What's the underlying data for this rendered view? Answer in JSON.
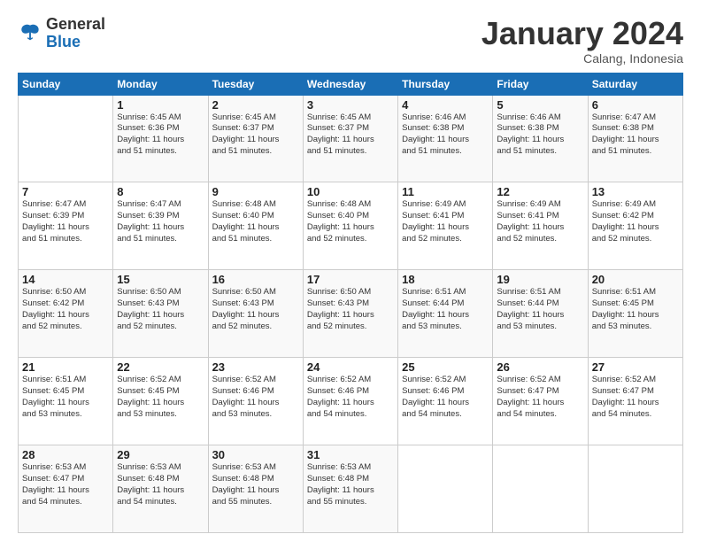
{
  "header": {
    "logo_general": "General",
    "logo_blue": "Blue",
    "month_title": "January 2024",
    "location": "Calang, Indonesia"
  },
  "days_of_week": [
    "Sunday",
    "Monday",
    "Tuesday",
    "Wednesday",
    "Thursday",
    "Friday",
    "Saturday"
  ],
  "weeks": [
    [
      {
        "day": "",
        "info": ""
      },
      {
        "day": "1",
        "info": "Sunrise: 6:45 AM\nSunset: 6:36 PM\nDaylight: 11 hours\nand 51 minutes."
      },
      {
        "day": "2",
        "info": "Sunrise: 6:45 AM\nSunset: 6:37 PM\nDaylight: 11 hours\nand 51 minutes."
      },
      {
        "day": "3",
        "info": "Sunrise: 6:45 AM\nSunset: 6:37 PM\nDaylight: 11 hours\nand 51 minutes."
      },
      {
        "day": "4",
        "info": "Sunrise: 6:46 AM\nSunset: 6:38 PM\nDaylight: 11 hours\nand 51 minutes."
      },
      {
        "day": "5",
        "info": "Sunrise: 6:46 AM\nSunset: 6:38 PM\nDaylight: 11 hours\nand 51 minutes."
      },
      {
        "day": "6",
        "info": "Sunrise: 6:47 AM\nSunset: 6:38 PM\nDaylight: 11 hours\nand 51 minutes."
      }
    ],
    [
      {
        "day": "7",
        "info": "Sunrise: 6:47 AM\nSunset: 6:39 PM\nDaylight: 11 hours\nand 51 minutes."
      },
      {
        "day": "8",
        "info": "Sunrise: 6:47 AM\nSunset: 6:39 PM\nDaylight: 11 hours\nand 51 minutes."
      },
      {
        "day": "9",
        "info": "Sunrise: 6:48 AM\nSunset: 6:40 PM\nDaylight: 11 hours\nand 51 minutes."
      },
      {
        "day": "10",
        "info": "Sunrise: 6:48 AM\nSunset: 6:40 PM\nDaylight: 11 hours\nand 52 minutes."
      },
      {
        "day": "11",
        "info": "Sunrise: 6:49 AM\nSunset: 6:41 PM\nDaylight: 11 hours\nand 52 minutes."
      },
      {
        "day": "12",
        "info": "Sunrise: 6:49 AM\nSunset: 6:41 PM\nDaylight: 11 hours\nand 52 minutes."
      },
      {
        "day": "13",
        "info": "Sunrise: 6:49 AM\nSunset: 6:42 PM\nDaylight: 11 hours\nand 52 minutes."
      }
    ],
    [
      {
        "day": "14",
        "info": "Sunrise: 6:50 AM\nSunset: 6:42 PM\nDaylight: 11 hours\nand 52 minutes."
      },
      {
        "day": "15",
        "info": "Sunrise: 6:50 AM\nSunset: 6:43 PM\nDaylight: 11 hours\nand 52 minutes."
      },
      {
        "day": "16",
        "info": "Sunrise: 6:50 AM\nSunset: 6:43 PM\nDaylight: 11 hours\nand 52 minutes."
      },
      {
        "day": "17",
        "info": "Sunrise: 6:50 AM\nSunset: 6:43 PM\nDaylight: 11 hours\nand 52 minutes."
      },
      {
        "day": "18",
        "info": "Sunrise: 6:51 AM\nSunset: 6:44 PM\nDaylight: 11 hours\nand 53 minutes."
      },
      {
        "day": "19",
        "info": "Sunrise: 6:51 AM\nSunset: 6:44 PM\nDaylight: 11 hours\nand 53 minutes."
      },
      {
        "day": "20",
        "info": "Sunrise: 6:51 AM\nSunset: 6:45 PM\nDaylight: 11 hours\nand 53 minutes."
      }
    ],
    [
      {
        "day": "21",
        "info": "Sunrise: 6:51 AM\nSunset: 6:45 PM\nDaylight: 11 hours\nand 53 minutes."
      },
      {
        "day": "22",
        "info": "Sunrise: 6:52 AM\nSunset: 6:45 PM\nDaylight: 11 hours\nand 53 minutes."
      },
      {
        "day": "23",
        "info": "Sunrise: 6:52 AM\nSunset: 6:46 PM\nDaylight: 11 hours\nand 53 minutes."
      },
      {
        "day": "24",
        "info": "Sunrise: 6:52 AM\nSunset: 6:46 PM\nDaylight: 11 hours\nand 54 minutes."
      },
      {
        "day": "25",
        "info": "Sunrise: 6:52 AM\nSunset: 6:46 PM\nDaylight: 11 hours\nand 54 minutes."
      },
      {
        "day": "26",
        "info": "Sunrise: 6:52 AM\nSunset: 6:47 PM\nDaylight: 11 hours\nand 54 minutes."
      },
      {
        "day": "27",
        "info": "Sunrise: 6:52 AM\nSunset: 6:47 PM\nDaylight: 11 hours\nand 54 minutes."
      }
    ],
    [
      {
        "day": "28",
        "info": "Sunrise: 6:53 AM\nSunset: 6:47 PM\nDaylight: 11 hours\nand 54 minutes."
      },
      {
        "day": "29",
        "info": "Sunrise: 6:53 AM\nSunset: 6:48 PM\nDaylight: 11 hours\nand 54 minutes."
      },
      {
        "day": "30",
        "info": "Sunrise: 6:53 AM\nSunset: 6:48 PM\nDaylight: 11 hours\nand 55 minutes."
      },
      {
        "day": "31",
        "info": "Sunrise: 6:53 AM\nSunset: 6:48 PM\nDaylight: 11 hours\nand 55 minutes."
      },
      {
        "day": "",
        "info": ""
      },
      {
        "day": "",
        "info": ""
      },
      {
        "day": "",
        "info": ""
      }
    ]
  ]
}
